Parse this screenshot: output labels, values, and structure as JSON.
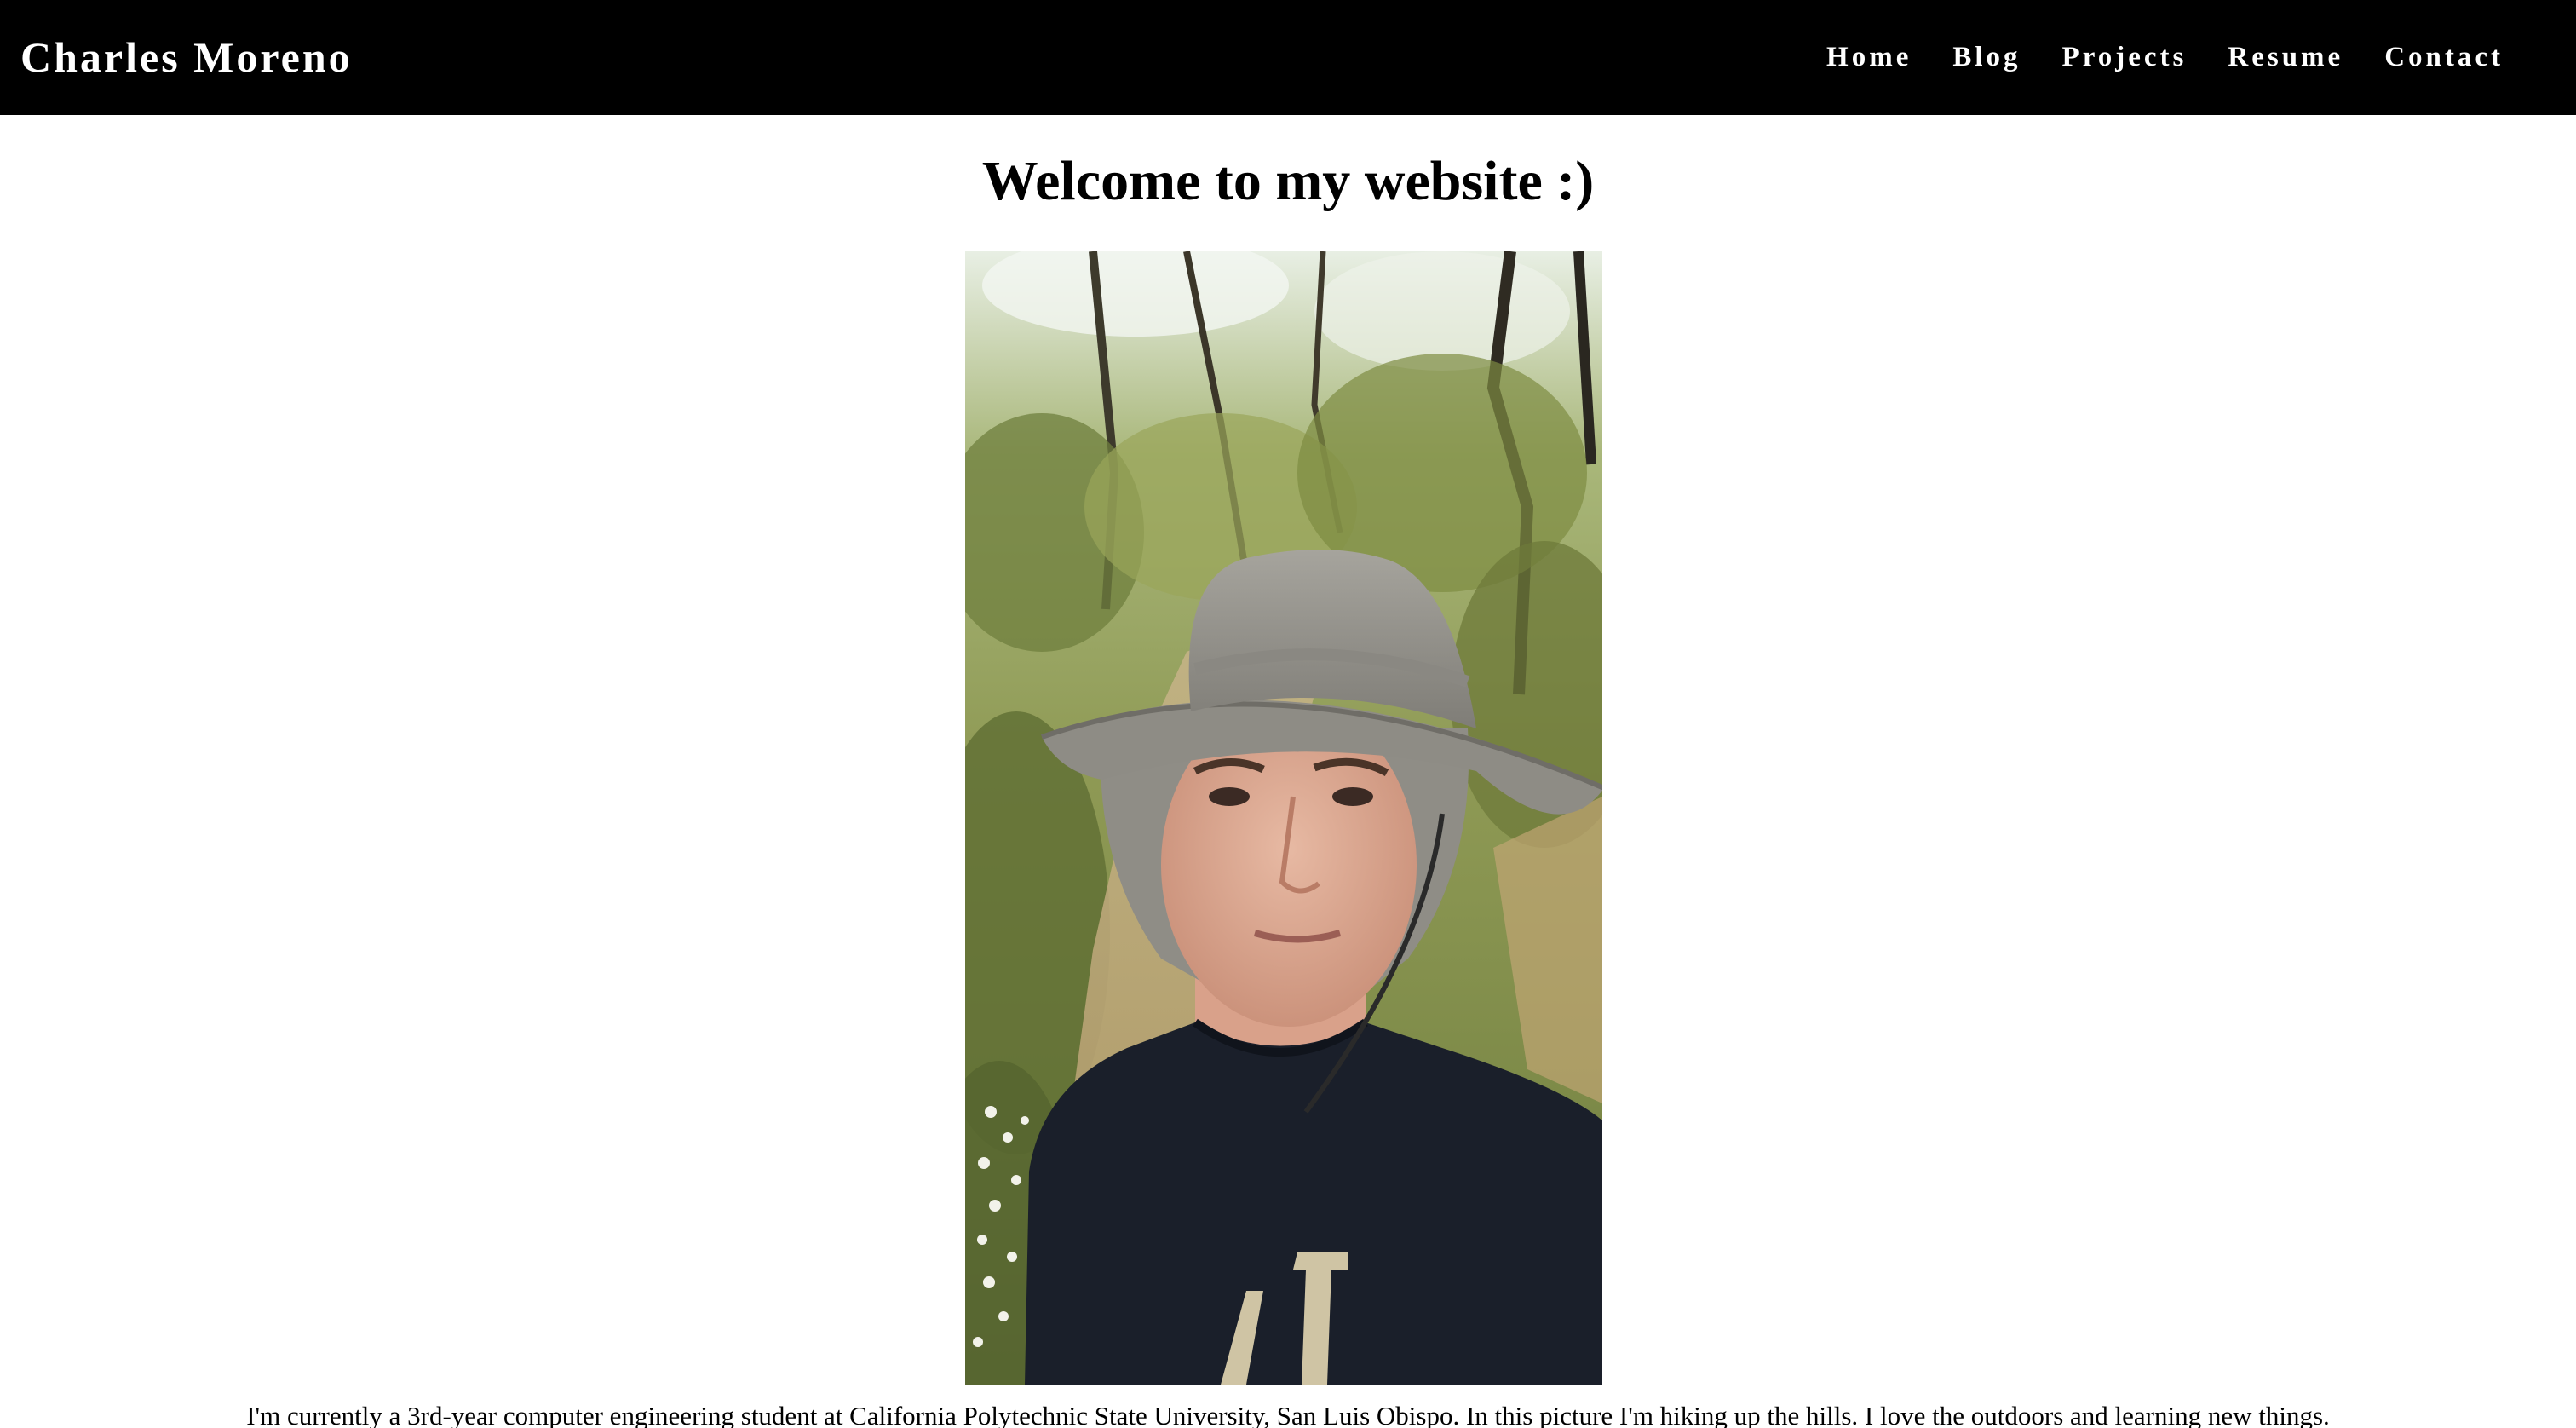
{
  "navbar": {
    "brand": "Charles Moreno",
    "links": [
      {
        "label": "Home"
      },
      {
        "label": "Blog"
      },
      {
        "label": "Projects"
      },
      {
        "label": "Resume"
      },
      {
        "label": "Contact"
      }
    ]
  },
  "main": {
    "heading": "Welcome to my website :)",
    "intro": "I'm currently a 3rd-year computer engineering student at California Polytechnic State University, San Luis Obispo. In this picture I'm hiking up the hills. I love the outdoors and learning new things."
  },
  "colors": {
    "navbar_bg": "#000000",
    "navbar_text": "#ffffff",
    "page_bg": "#ffffff",
    "text": "#000000"
  }
}
